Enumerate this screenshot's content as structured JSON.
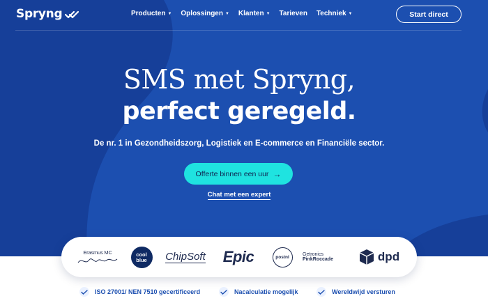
{
  "nav": {
    "logo_text": "Spryng",
    "items": [
      {
        "label": "Producten",
        "has_caret": true
      },
      {
        "label": "Oplossingen",
        "has_caret": true
      },
      {
        "label": "Klanten",
        "has_caret": true
      },
      {
        "label": "Tarieven",
        "has_caret": false
      },
      {
        "label": "Techniek",
        "has_caret": true
      }
    ],
    "cta_label": "Start direct"
  },
  "hero": {
    "headline_line1": "SMS met Spryng,",
    "headline_line2": "perfect geregeld.",
    "subline": "De nr. 1 in Gezondheidszorg, Logistiek en E-commerce en Financiële sector.",
    "cta_label": "Offerte binnen een uur",
    "cta_icon": "arrow-right-icon",
    "secondary_link": "Chat met een expert"
  },
  "clients": {
    "erasmus": "Erasmus MC",
    "coolblue_line1": "cool",
    "coolblue_line2": "blue",
    "chipsoft": "ChipSoft",
    "epic": "Epic",
    "postnl": "postnl",
    "getronics_line1": "Getronics",
    "getronics_line2": "PinkRoccade",
    "dpd": "dpd"
  },
  "features": [
    {
      "label": "ISO 27001/ NEN 7510 gecertificeerd",
      "icon": "check-icon"
    },
    {
      "label": "Nacalculatie mogelijk",
      "icon": "check-icon"
    },
    {
      "label": "Wereldwijd versturen",
      "icon": "check-icon"
    }
  ],
  "colors": {
    "hero_blue": "#1c4fb0",
    "hero_dark": "#163f99",
    "accent_cyan": "#1fe3e0",
    "text_navy": "#1e2a4f"
  }
}
